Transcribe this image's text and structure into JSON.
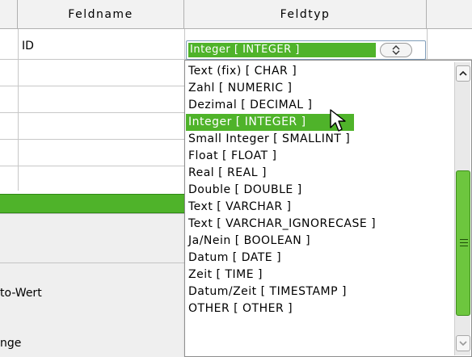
{
  "table": {
    "columns": [
      "Feldname",
      "Feldtyp"
    ],
    "row1_field_name": "ID"
  },
  "field_type_combo": {
    "value": "Integer [ INTEGER ]"
  },
  "field_type_options": [
    "Text (fix) [ CHAR ]",
    "Zahl [ NUMERIC ]",
    "Dezimal [ DECIMAL ]",
    "Integer [ INTEGER ]",
    "Small Integer [ SMALLINT ]",
    "Float [ FLOAT ]",
    "Real [ REAL ]",
    "Double [ DOUBLE ]",
    "Text [ VARCHAR ]",
    "Text [ VARCHAR_IGNORECASE ]",
    "Ja/Nein [ BOOLEAN ]",
    "Datum [ DATE ]",
    "Zeit [ TIME ]",
    "Datum/Zeit [ TIMESTAMP ]",
    "OTHER [ OTHER ]"
  ],
  "selected_option_index": 3,
  "properties": {
    "auto_value_label": "to-Wert",
    "length_label": "nge"
  },
  "colors": {
    "accent": "#4fb32a",
    "header_bg": "#f2f2f2",
    "panel_bg": "#efefef"
  },
  "icons": {
    "combo_button": "spin-updown-icon",
    "scroll_up": "chevron-up-icon",
    "scroll_down": "chevron-down-icon",
    "cursor": "mouse-pointer-icon"
  }
}
